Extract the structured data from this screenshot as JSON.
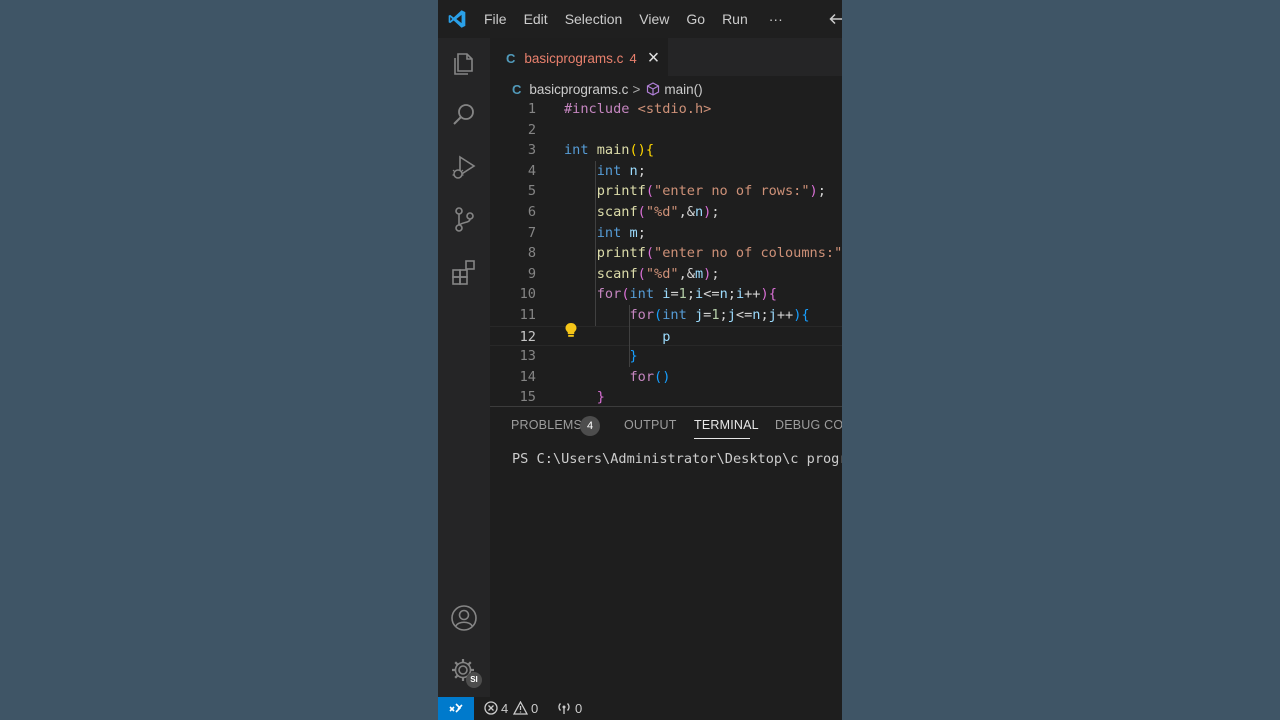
{
  "menu": [
    "File",
    "Edit",
    "Selection",
    "View",
    "Go",
    "Run",
    "···"
  ],
  "tab": {
    "icon_letter": "C",
    "filename": "basicprograms.c",
    "problem_count": "4",
    "close_glyph": "×"
  },
  "breadcrumb": {
    "file": "basicprograms.c",
    "separator": ">",
    "symbol": "main()"
  },
  "code_lines": [
    {
      "num": "1",
      "tokens": [
        [
          "#include ",
          "t-ctl"
        ],
        [
          "<stdio.h>",
          "t-str"
        ]
      ]
    },
    {
      "num": "2",
      "tokens": []
    },
    {
      "num": "3",
      "tokens": [
        [
          "int ",
          "t-kw"
        ],
        [
          "main",
          "t-fn"
        ],
        [
          "()",
          "t-b1"
        ],
        [
          "{",
          "t-b1"
        ]
      ]
    },
    {
      "num": "4",
      "tokens": [
        [
          "    "
        ],
        [
          "int ",
          "t-kw"
        ],
        [
          "n",
          "t-var"
        ],
        [
          ";",
          "t-pl"
        ]
      ]
    },
    {
      "num": "5",
      "tokens": [
        [
          "    "
        ],
        [
          "printf",
          "t-fn"
        ],
        [
          "(",
          "t-b2"
        ],
        [
          "\"enter no of rows:\"",
          "t-str"
        ],
        [
          ")",
          "t-b2"
        ],
        [
          ";",
          "t-pl"
        ]
      ]
    },
    {
      "num": "6",
      "tokens": [
        [
          "    "
        ],
        [
          "scanf",
          "t-fn"
        ],
        [
          "(",
          "t-b2"
        ],
        [
          "\"%d\"",
          "t-str"
        ],
        [
          ",&",
          "t-pl"
        ],
        [
          "n",
          "t-var"
        ],
        [
          ")",
          "t-b2"
        ],
        [
          ";",
          "t-pl"
        ]
      ]
    },
    {
      "num": "7",
      "tokens": [
        [
          "    "
        ],
        [
          "int ",
          "t-kw"
        ],
        [
          "m",
          "t-var"
        ],
        [
          ";",
          "t-pl"
        ]
      ]
    },
    {
      "num": "8",
      "tokens": [
        [
          "    "
        ],
        [
          "printf",
          "t-fn"
        ],
        [
          "(",
          "t-b2"
        ],
        [
          "\"enter no of coloumns:\"",
          "t-str"
        ]
      ]
    },
    {
      "num": "9",
      "tokens": [
        [
          "    "
        ],
        [
          "scanf",
          "t-fn"
        ],
        [
          "(",
          "t-b2"
        ],
        [
          "\"%d\"",
          "t-str"
        ],
        [
          ",&",
          "t-pl"
        ],
        [
          "m",
          "t-var"
        ],
        [
          ")",
          "t-b2"
        ],
        [
          ";",
          "t-pl"
        ]
      ]
    },
    {
      "num": "10",
      "tokens": [
        [
          "    "
        ],
        [
          "for",
          "t-ctl"
        ],
        [
          "(",
          "t-b2"
        ],
        [
          "int ",
          "t-kw"
        ],
        [
          "i",
          "t-var"
        ],
        [
          "=",
          "t-pl"
        ],
        [
          "1",
          "t-num"
        ],
        [
          ";",
          "t-pl"
        ],
        [
          "i",
          "t-var"
        ],
        [
          "<=",
          "t-pl"
        ],
        [
          "n",
          "t-var"
        ],
        [
          ";",
          "t-pl"
        ],
        [
          "i",
          "t-var"
        ],
        [
          "++",
          "t-pl"
        ],
        [
          ")",
          "t-b2"
        ],
        [
          "{",
          "t-b2"
        ]
      ]
    },
    {
      "num": "11",
      "tokens": [
        [
          "        "
        ],
        [
          "for",
          "t-ctl"
        ],
        [
          "(",
          "t-b3"
        ],
        [
          "int ",
          "t-kw"
        ],
        [
          "j",
          "t-var"
        ],
        [
          "=",
          "t-pl"
        ],
        [
          "1",
          "t-num"
        ],
        [
          ";",
          "t-pl"
        ],
        [
          "j",
          "t-var"
        ],
        [
          "<=",
          "t-pl"
        ],
        [
          "n",
          "t-var"
        ],
        [
          ";",
          "t-pl"
        ],
        [
          "j",
          "t-var"
        ],
        [
          "++",
          "t-pl"
        ],
        [
          ")",
          "t-b3"
        ],
        [
          "{",
          "t-b3"
        ]
      ]
    },
    {
      "num": "12",
      "tokens": [
        [
          "            "
        ],
        [
          "p",
          "t-var"
        ]
      ]
    },
    {
      "num": "13",
      "tokens": [
        [
          "        "
        ],
        [
          "}",
          "t-b3"
        ]
      ]
    },
    {
      "num": "14",
      "tokens": [
        [
          "        "
        ],
        [
          "for",
          "t-ctl"
        ],
        [
          "(",
          "t-b3"
        ],
        [
          ")",
          "t-b3"
        ]
      ]
    },
    {
      "num": "15",
      "tokens": [
        [
          "    "
        ],
        [
          "}",
          "t-b2"
        ]
      ]
    }
  ],
  "current_line": "12",
  "panel": {
    "tabs": [
      "PROBLEMS",
      "OUTPUT",
      "TERMINAL",
      "DEBUG CON"
    ],
    "problems_badge": "4",
    "active_tab": "TERMINAL",
    "terminal_text": "PS C:\\Users\\Administrator\\Desktop\\c program"
  },
  "status": {
    "errors": "4",
    "warnings": "0",
    "ports": "0"
  },
  "account_badge": "SI",
  "colors": {
    "page_background": "#3f5566",
    "accent": "#007acc",
    "vscode_logo": "#2aa0e8",
    "tab_modified_text": "#e8806d",
    "c_file_icon": "#519aba",
    "symbol_icon": "#b180d7",
    "lightbulb": "#f5c518"
  },
  "icons": {
    "logo": "vscode-logo-icon",
    "activity": [
      "explorer-files-icon",
      "search-icon",
      "run-debug-icon",
      "source-control-icon",
      "extensions-icon",
      "account-icon",
      "settings-gear-icon"
    ],
    "breadcrumb_symbol": "cube-symbol-icon",
    "editor_hint": "lightbulb-icon",
    "status": [
      "remote-indicator-icon",
      "error-circle-icon",
      "warning-triangle-icon",
      "ports-antenna-icon"
    ]
  }
}
